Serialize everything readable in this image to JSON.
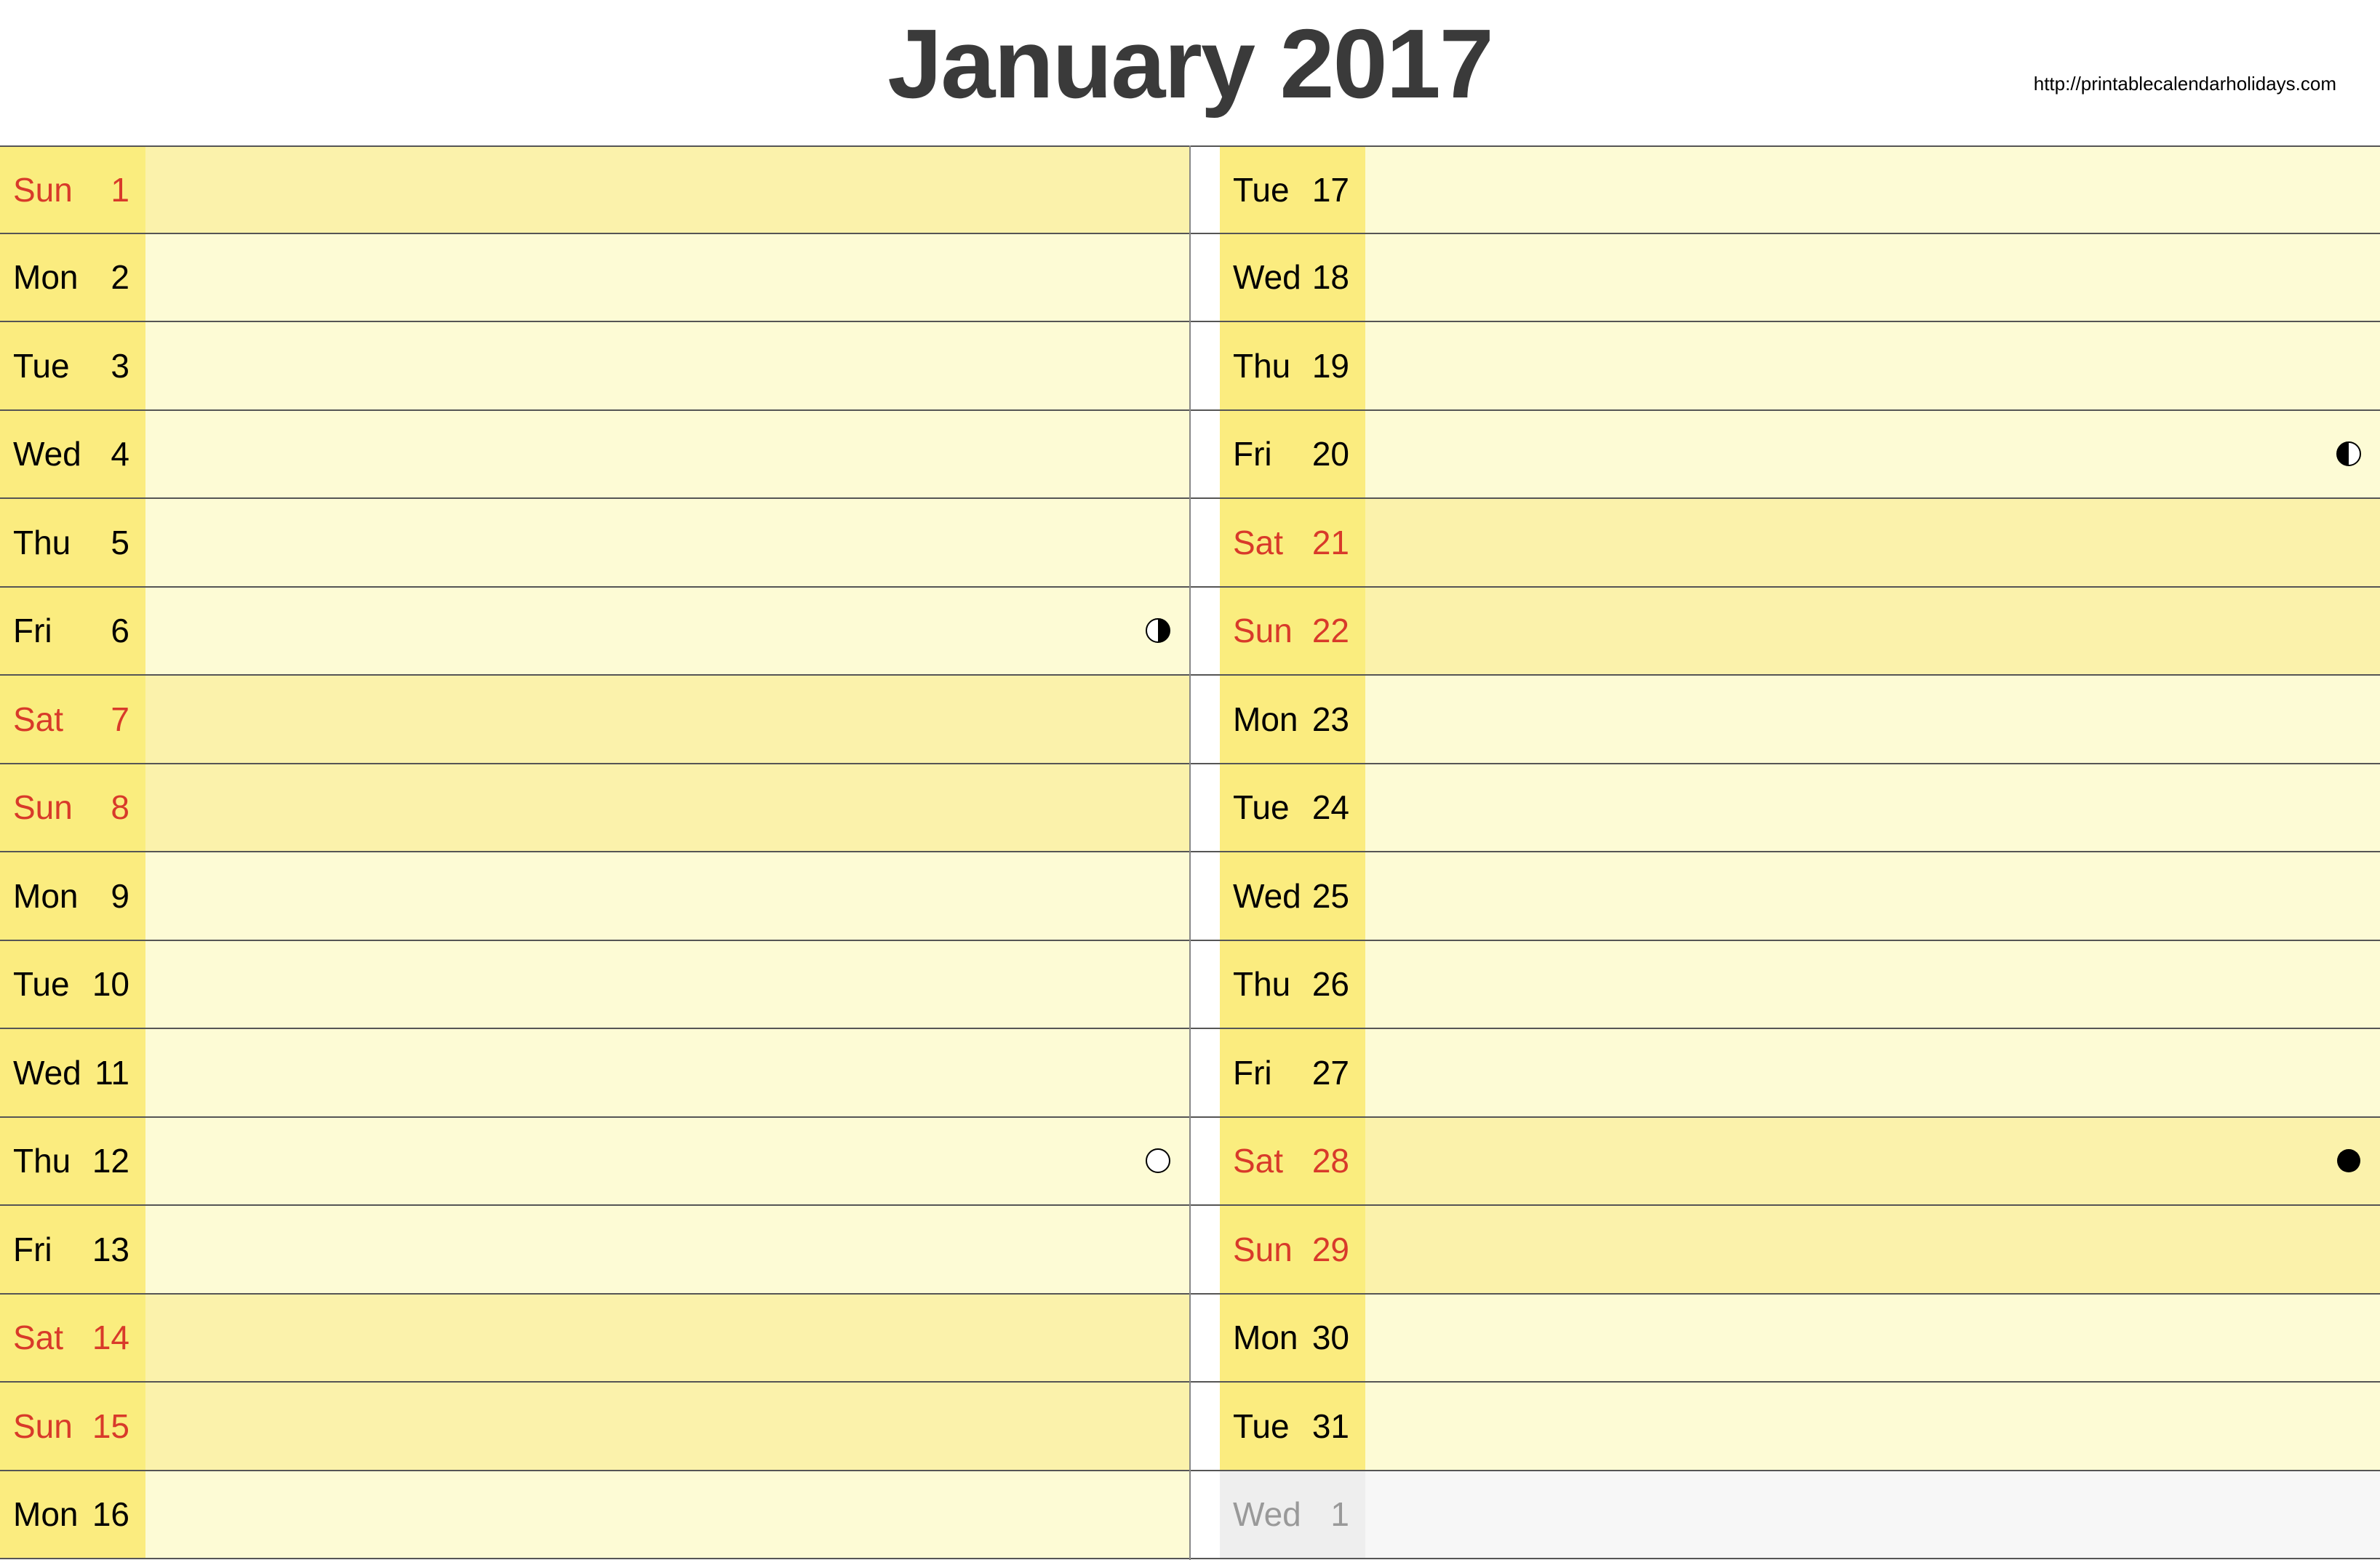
{
  "header": {
    "title": "January 2017",
    "source_url": "http://printablecalendarholidays.com"
  },
  "colors": {
    "weekday_bg_label": "#fbec7f",
    "weekday_bg_note": "#fdfbd5",
    "weekend_bg_label": "#faed7e",
    "weekend_bg_note": "#fbf2ab",
    "nextmonth_bg_label": "#eeeeee",
    "nextmonth_bg_note": "#f7f7f7",
    "weekend_text": "#d83a2a"
  },
  "columns": {
    "left": [
      {
        "dow": "Sun",
        "num": "1",
        "type": "weekend",
        "moon": null
      },
      {
        "dow": "Mon",
        "num": "2",
        "type": "weekday",
        "moon": null
      },
      {
        "dow": "Tue",
        "num": "3",
        "type": "weekday",
        "moon": null
      },
      {
        "dow": "Wed",
        "num": "4",
        "type": "weekday",
        "moon": null
      },
      {
        "dow": "Thu",
        "num": "5",
        "type": "weekday",
        "moon": null
      },
      {
        "dow": "Fri",
        "num": "6",
        "type": "weekday",
        "moon": "first-quarter"
      },
      {
        "dow": "Sat",
        "num": "7",
        "type": "weekend",
        "moon": null
      },
      {
        "dow": "Sun",
        "num": "8",
        "type": "weekend",
        "moon": null
      },
      {
        "dow": "Mon",
        "num": "9",
        "type": "weekday",
        "moon": null
      },
      {
        "dow": "Tue",
        "num": "10",
        "type": "weekday",
        "moon": null
      },
      {
        "dow": "Wed",
        "num": "11",
        "type": "weekday",
        "moon": null
      },
      {
        "dow": "Thu",
        "num": "12",
        "type": "weekday",
        "moon": "full"
      },
      {
        "dow": "Fri",
        "num": "13",
        "type": "weekday",
        "moon": null
      },
      {
        "dow": "Sat",
        "num": "14",
        "type": "weekend",
        "moon": null
      },
      {
        "dow": "Sun",
        "num": "15",
        "type": "weekend",
        "moon": null
      },
      {
        "dow": "Mon",
        "num": "16",
        "type": "weekday",
        "moon": null
      }
    ],
    "right": [
      {
        "dow": "Tue",
        "num": "17",
        "type": "weekday",
        "moon": null
      },
      {
        "dow": "Wed",
        "num": "18",
        "type": "weekday",
        "moon": null
      },
      {
        "dow": "Thu",
        "num": "19",
        "type": "weekday",
        "moon": null
      },
      {
        "dow": "Fri",
        "num": "20",
        "type": "weekday",
        "moon": "last-quarter"
      },
      {
        "dow": "Sat",
        "num": "21",
        "type": "weekend",
        "moon": null
      },
      {
        "dow": "Sun",
        "num": "22",
        "type": "weekend",
        "moon": null
      },
      {
        "dow": "Mon",
        "num": "23",
        "type": "weekday",
        "moon": null
      },
      {
        "dow": "Tue",
        "num": "24",
        "type": "weekday",
        "moon": null
      },
      {
        "dow": "Wed",
        "num": "25",
        "type": "weekday",
        "moon": null
      },
      {
        "dow": "Thu",
        "num": "26",
        "type": "weekday",
        "moon": null
      },
      {
        "dow": "Fri",
        "num": "27",
        "type": "weekday",
        "moon": null
      },
      {
        "dow": "Sat",
        "num": "28",
        "type": "weekend",
        "moon": "new"
      },
      {
        "dow": "Sun",
        "num": "29",
        "type": "weekend",
        "moon": null
      },
      {
        "dow": "Mon",
        "num": "30",
        "type": "weekday",
        "moon": null
      },
      {
        "dow": "Tue",
        "num": "31",
        "type": "weekday",
        "moon": null
      },
      {
        "dow": "Wed",
        "num": "1",
        "type": "nextmonth",
        "moon": null
      }
    ]
  }
}
